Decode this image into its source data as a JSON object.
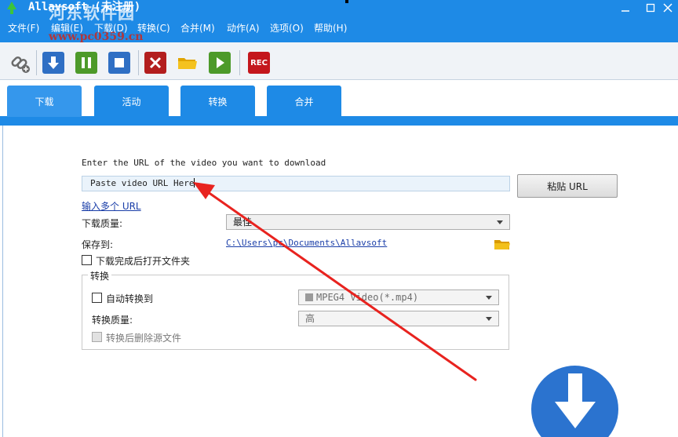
{
  "window": {
    "title": "Allavsoft (未注册)",
    "watermark_text": "河东软件园",
    "watermark_url": "www.pc0359.cn"
  },
  "menu": [
    "文件(F)",
    "编辑(E)",
    "下载(D)",
    "转换(C)",
    "合并(M)",
    "动作(A)",
    "选项(O)",
    "帮助(H)"
  ],
  "toolbar": {
    "rec_label": "REC"
  },
  "tabs": [
    "下载",
    "活动",
    "转换",
    "合并"
  ],
  "download": {
    "url_prompt": "Enter the URL of the video you want to download",
    "url_value": "Paste video URL Here",
    "paste_button": "粘贴 URL",
    "multi_url_link": "输入多个 URL",
    "quality_label": "下载质量:",
    "quality_value": "最佳",
    "save_label": "保存到:",
    "save_path": "C:\\Users\\pc\\Documents\\Allavsoft",
    "open_folder_label": "下载完成后打开文件夹"
  },
  "convert": {
    "group_label": "转换",
    "auto_convert_label": "自动转换到",
    "format_value": "MPEG4 Video(*.mp4)",
    "quality_label": "转换质量:",
    "quality_value": "高",
    "delete_source_label": "转换后删除源文件"
  },
  "colors": {
    "accent": "#1e8ae6",
    "download_button": "#2b73cf",
    "annotation_arrow": "#e8231f"
  }
}
